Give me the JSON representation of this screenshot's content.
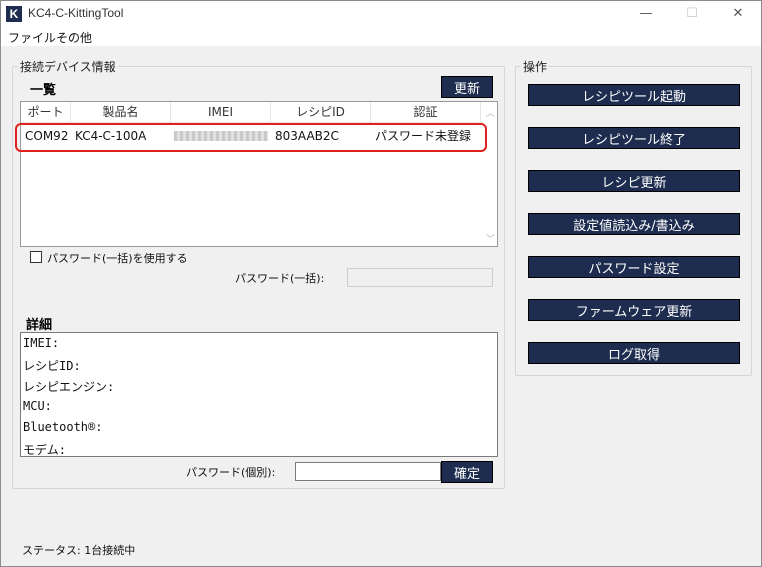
{
  "window": {
    "title": "KC4-C-KittingTool",
    "logo_letter": "K",
    "controls": {
      "minimize": "—",
      "maximize": "☐",
      "close": "✕"
    }
  },
  "menu": {
    "items": [
      "ファイル",
      "その他"
    ]
  },
  "device_group": {
    "legend": "接続デバイス情報",
    "list_label": "一覧",
    "refresh_button": "更新",
    "columns": [
      "ポート",
      "製品名",
      "IMEI",
      "レシピID",
      "認証"
    ],
    "rows": [
      {
        "port": "COM92",
        "product": "KC4-C-100A",
        "imei": "",
        "recipe_id": "803AAB2C",
        "auth": "パスワード未登録"
      }
    ],
    "bulk_password_checkbox": "パスワード(一括)を使用する",
    "bulk_password_label": "パスワード(一括):",
    "bulk_password_value": "",
    "details_label": "詳細",
    "details_lines": [
      "IMEI:",
      "レシピID:",
      "レシピエンジン:",
      "MCU:",
      "Bluetooth®:",
      "モデム:"
    ],
    "individual_password_label": "パスワード(個別):",
    "individual_password_value": "",
    "confirm_button": "確定"
  },
  "operations": {
    "legend": "操作",
    "buttons": [
      "レシピツール起動",
      "レシピツール終了",
      "レシピ更新",
      "設定値読込み/書込み",
      "パスワード設定",
      "ファームウェア更新",
      "ログ取得"
    ]
  },
  "status": {
    "text": "ステータス: 1台接続中"
  },
  "colors": {
    "button_bg": "#1e2d4f",
    "highlight": "#e0201c"
  }
}
